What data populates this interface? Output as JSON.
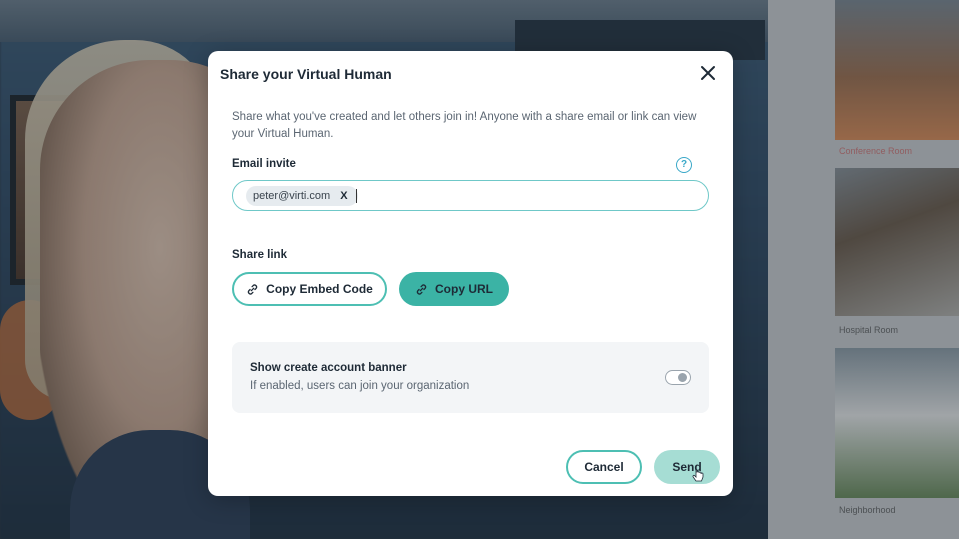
{
  "modal": {
    "title": "Share your Virtual Human",
    "description": "Share what you've created and let others join in! Anyone with a share email or link can view your Virtual Human.",
    "email_invite": {
      "label": "Email invite",
      "help_icon": "question-circle-icon",
      "chips": [
        "peter@virti.com"
      ],
      "chip_remove": "X"
    },
    "share_link": {
      "label": "Share link",
      "copy_embed_label": "Copy Embed Code",
      "copy_url_label": "Copy URL",
      "link_icon": "link-icon"
    },
    "account_banner": {
      "title": "Show create account banner",
      "subtitle": "If enabled, users can join your organization",
      "enabled": false
    },
    "footer": {
      "cancel_label": "Cancel",
      "send_label": "Send"
    }
  },
  "sidebar": {
    "environments": [
      "Conference Room",
      "Hospital Room",
      "Neighborhood"
    ]
  },
  "colors": {
    "accent": "#3bb3a5",
    "accent_border": "#4dbfb3",
    "send_disabled": "#a6ddd4",
    "text_dark": "#1e2a36",
    "text_muted": "#5b6672"
  }
}
